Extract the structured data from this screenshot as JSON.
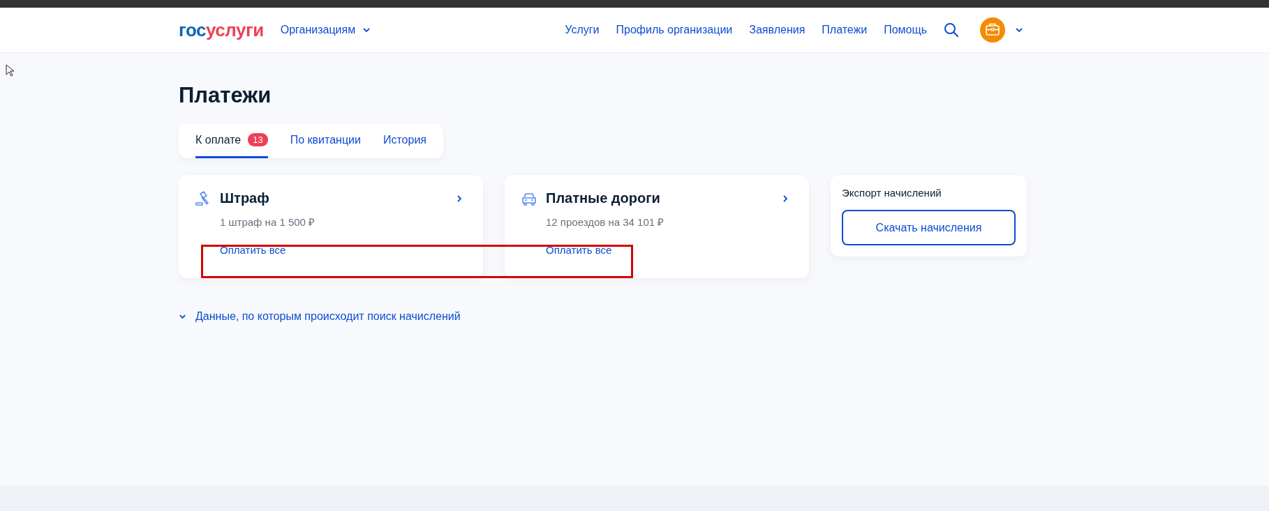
{
  "header": {
    "logo": {
      "first": "гос",
      "second": "услуги"
    },
    "org_menu": "Организациям",
    "nav": [
      "Услуги",
      "Профиль организации",
      "Заявления",
      "Платежи",
      "Помощь"
    ]
  },
  "page_title": "Платежи",
  "tabs": [
    {
      "label": "К оплате",
      "badge": "13",
      "selected": true
    },
    {
      "label": "По квитанции",
      "selected": false
    },
    {
      "label": "История",
      "selected": false
    }
  ],
  "cards": [
    {
      "kind": "fine",
      "title": "Штраф",
      "summary": "1 штраф на 1 500 ₽",
      "action": "Оплатить все"
    },
    {
      "kind": "roads",
      "title": "Платные дороги",
      "summary": "12 проездов на 34 101 ₽",
      "action": "Оплатить все"
    }
  ],
  "export": {
    "title": "Экспорт начислений",
    "button": "Скачать начисления"
  },
  "search_data_toggle": {
    "label": "Данные, по которым происходит поиск начислений",
    "expanded": false
  }
}
